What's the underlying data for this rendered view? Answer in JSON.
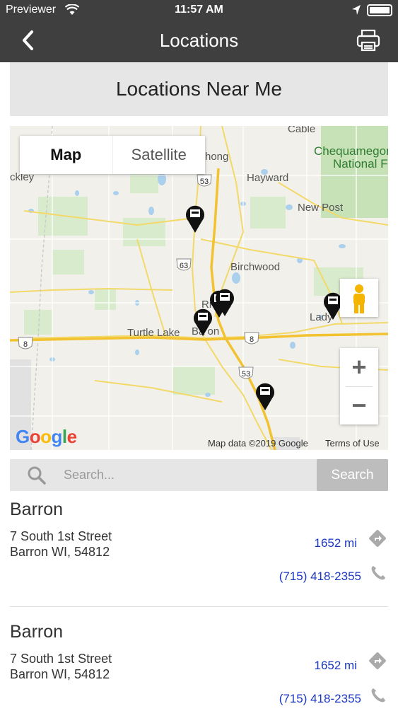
{
  "status_bar": {
    "carrier": "Previewer",
    "time": "11:57 AM"
  },
  "nav": {
    "title": "Locations"
  },
  "section": {
    "title": "Locations Near Me"
  },
  "map": {
    "toggle": {
      "map_label": "Map",
      "satellite_label": "Satellite"
    },
    "labels": {
      "cable": "Cable",
      "chequamegon": "Chequamegon",
      "national": "National F",
      "hong": "hong",
      "kley": "ckley",
      "hayward": "Hayward",
      "new_post": "New Post",
      "birchwood": "Birchwood",
      "rice_lake": "Ri    ake",
      "turtle_lake": "Turtle Lake",
      "barron": "Ba   on",
      "ladysmith": "Lady",
      "r53a": "53",
      "r63": "63",
      "r53b": "53",
      "r8a": "8",
      "r8b": "8"
    },
    "google": "Google",
    "attribution": "Map data ©2019 Google",
    "terms": "Terms of Use",
    "pin_count": 6
  },
  "search": {
    "placeholder": "Search...",
    "button_label": "Search"
  },
  "locations": [
    {
      "name": "Barron",
      "address_line1": "7 South 1st Street",
      "address_line2": "Barron WI, 54812",
      "distance": "1652 mi",
      "phone": "(715) 418-2355"
    },
    {
      "name": "Barron",
      "address_line1": "7 South 1st Street",
      "address_line2": "Barron WI, 54812",
      "distance": "1652 mi",
      "phone": "(715) 418-2355"
    }
  ],
  "colors": {
    "nav_bg": "#3f3f3f",
    "link": "#1a37c2",
    "header_bg": "#e6e6e6",
    "search_btn": "#bdbdbd"
  }
}
